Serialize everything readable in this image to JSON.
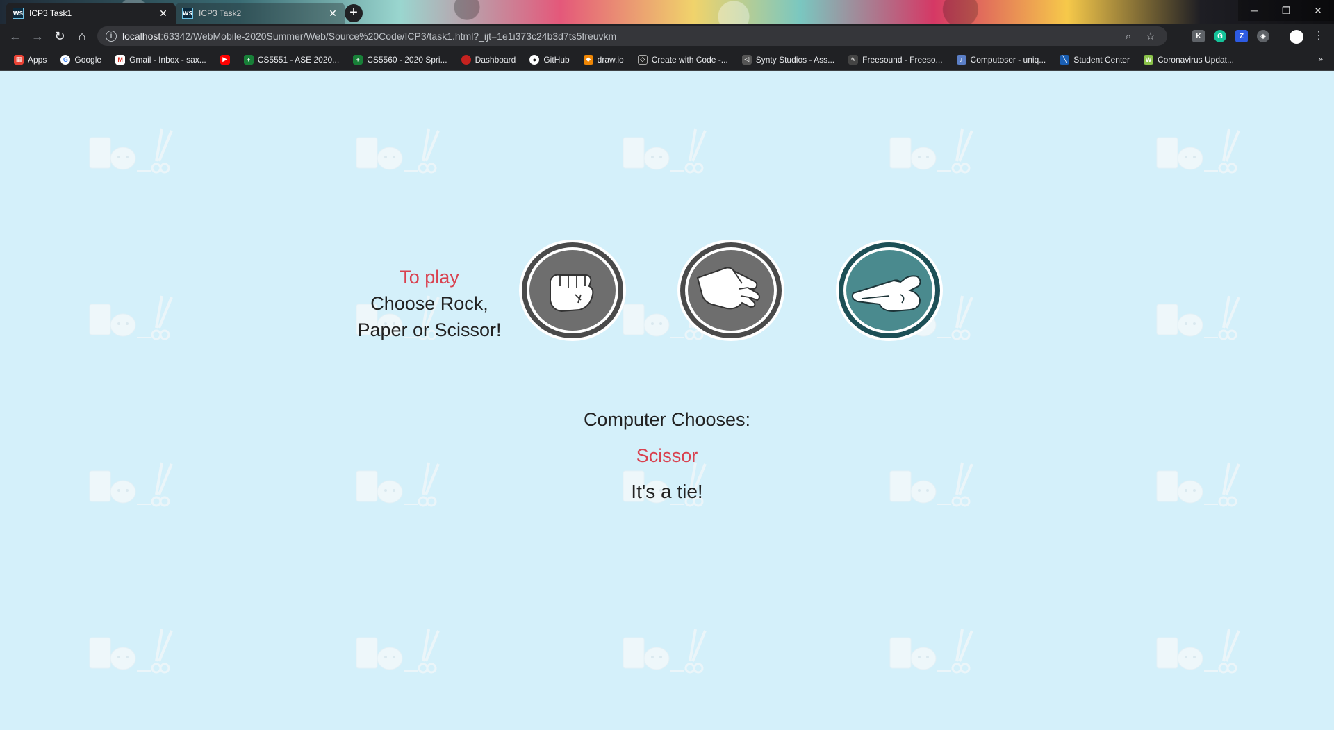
{
  "browser": {
    "tabs": [
      {
        "title": "ICP3 Task1",
        "icon": "WS",
        "active": true
      },
      {
        "title": "ICP3 Task2",
        "icon": "WS",
        "active": false
      }
    ],
    "url_host": "localhost",
    "url_rest": ":63342/WebMobile-2020Summer/Web/Source%20Code/ICP3/task1.html?_ijt=1e1i373c24b3d7ts5freuvkm",
    "bookmarks": [
      {
        "label": "Apps",
        "icon": "apps-grid-icon",
        "color": "#ea4335"
      },
      {
        "label": "Google",
        "icon": "google-icon",
        "color": "#4285f4"
      },
      {
        "label": "Gmail - Inbox - sax...",
        "icon": "gmail-icon",
        "color": "#d93025"
      },
      {
        "label": "",
        "icon": "youtube-icon",
        "color": "#ff0000"
      },
      {
        "label": "CS5551 - ASE 2020...",
        "icon": "plus-green-icon",
        "color": "#188038"
      },
      {
        "label": "CS5560 - 2020 Spri...",
        "icon": "plus-green-icon",
        "color": "#188038"
      },
      {
        "label": "Dashboard",
        "icon": "dashboard-icon",
        "color": "#c5221f"
      },
      {
        "label": "GitHub",
        "icon": "github-icon",
        "color": "#444444"
      },
      {
        "label": "draw.io",
        "icon": "drawio-icon",
        "color": "#f08705"
      },
      {
        "label": "Create with Code -...",
        "icon": "unity-icon",
        "color": "#222222"
      },
      {
        "label": "Synty Studios - Ass...",
        "icon": "synty-icon",
        "color": "#555555"
      },
      {
        "label": "Freesound - Freeso...",
        "icon": "freesound-icon",
        "color": "#444444"
      },
      {
        "label": "Computoser - uniq...",
        "icon": "computoser-icon",
        "color": "#5b7fc7"
      },
      {
        "label": "Student Center",
        "icon": "student-center-icon",
        "color": "#1a5fb4"
      },
      {
        "label": "Coronavirus Updat...",
        "icon": "worldometer-icon",
        "color": "#8bc34a"
      }
    ],
    "more_bookmarks": "»"
  },
  "game": {
    "to_play": "To play",
    "choose_line1": "Choose Rock,",
    "choose_line2": "Paper or Scissor!",
    "choices": [
      {
        "name": "rock",
        "icon": "rock-fist-icon",
        "selected": false
      },
      {
        "name": "paper",
        "icon": "paper-hand-icon",
        "selected": false
      },
      {
        "name": "scissor",
        "icon": "scissor-hand-icon",
        "selected": true
      }
    ],
    "computer_label": "Computer Chooses:",
    "computer_choice": "Scissor",
    "result": "It's a tie!",
    "colors": {
      "accent": "#d9414f",
      "selected_ring": "#1d4f56",
      "selected_fill": "#4a8a8e",
      "unselected_ring": "#4a4a4a",
      "unselected_fill": "#6e6e6e",
      "background": "#d4f0fa"
    }
  }
}
